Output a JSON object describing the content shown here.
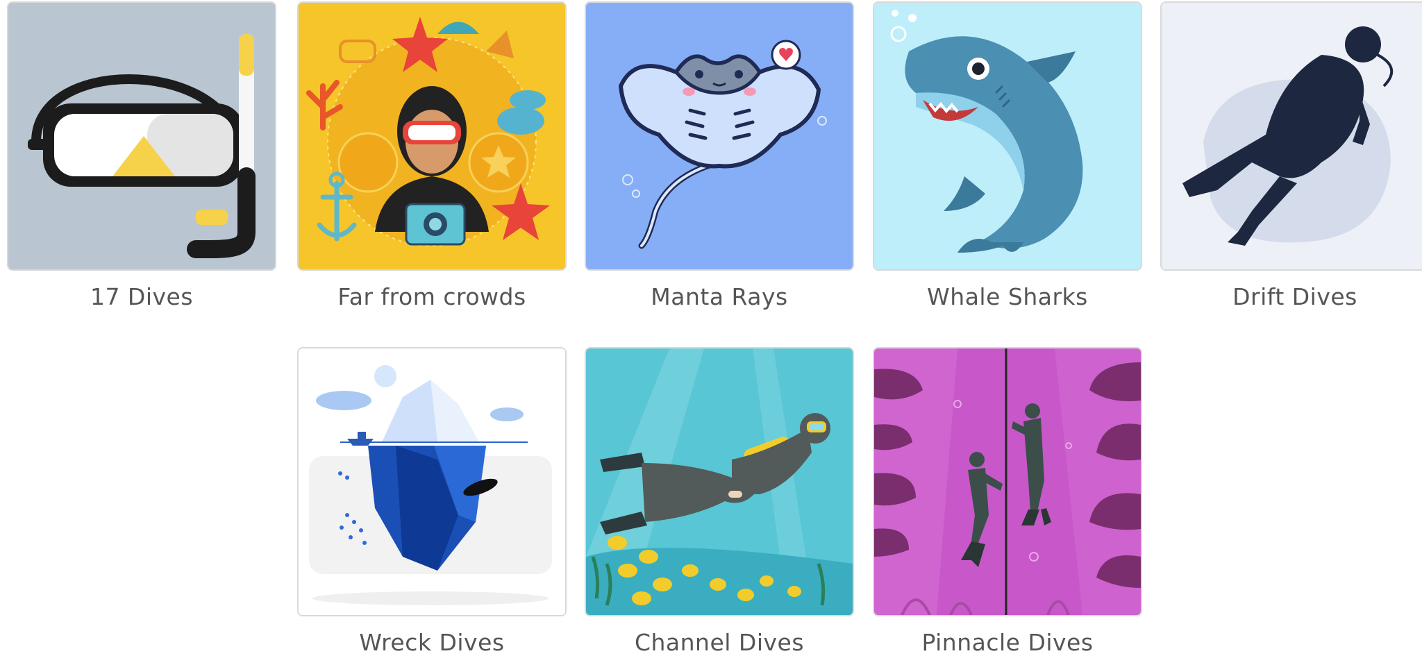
{
  "items": [
    {
      "label": "17 Dives",
      "icon": "snorkel-mask-icon"
    },
    {
      "label": "Far from crowds",
      "icon": "diver-badges-icon"
    },
    {
      "label": "Manta Rays",
      "icon": "manta-ray-icon"
    },
    {
      "label": "Whale Sharks",
      "icon": "shark-icon"
    },
    {
      "label": "Drift Dives",
      "icon": "diver-silhouette-icon"
    },
    {
      "label": "Wreck Dives",
      "icon": "iceberg-icon"
    },
    {
      "label": "Channel Dives",
      "icon": "swimming-diver-icon"
    },
    {
      "label": "Pinnacle Dives",
      "icon": "divers-rope-icon"
    }
  ],
  "colors": {
    "snorkel_bg": "#b9c6d1",
    "crowds_bg": "#f5c52a",
    "manta_bg": "#86aef6",
    "shark_bg": "#bdeefa",
    "drift_bg": "#eef0f7",
    "wreck_bg": "#ffffff",
    "channel_bg": "#58c6d4",
    "pinnacle_bg": "#c858c9",
    "label_text": "#555555"
  }
}
